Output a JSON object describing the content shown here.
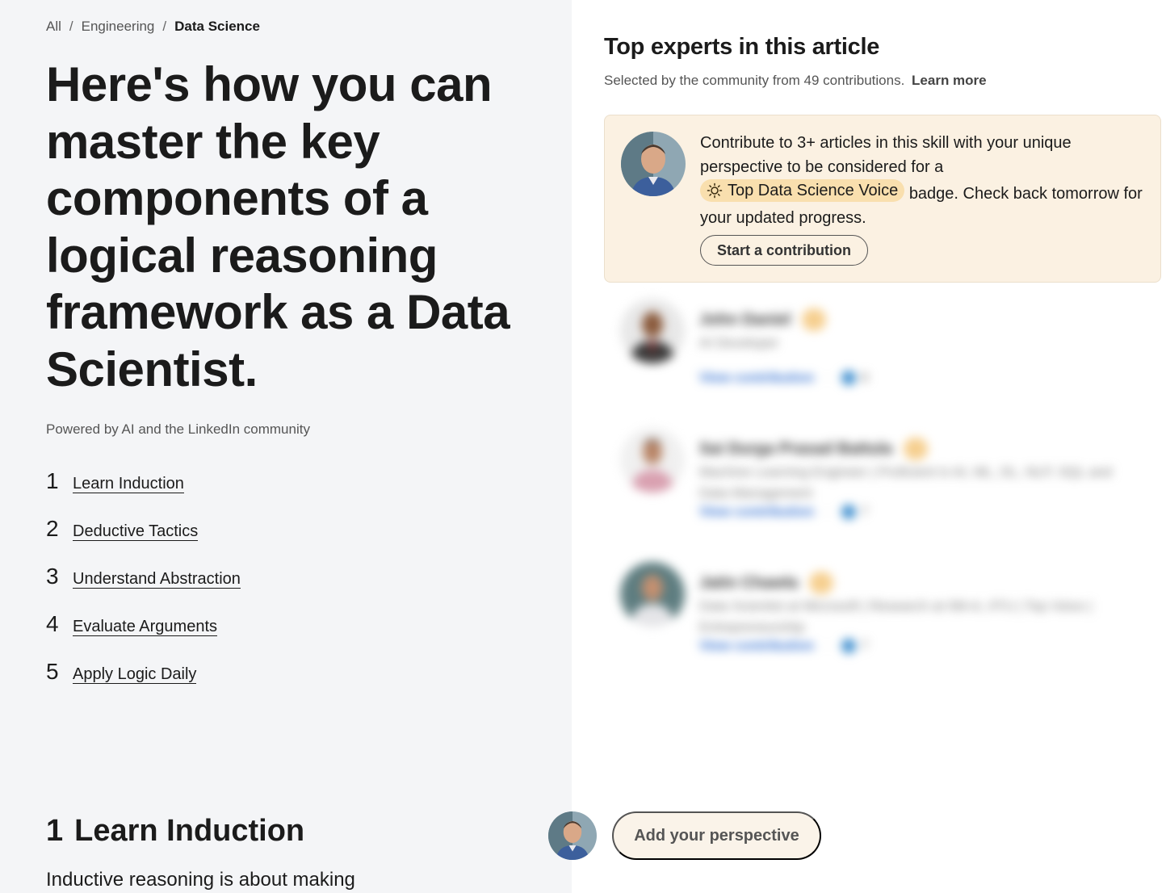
{
  "breadcrumb": {
    "items": [
      "All",
      "Engineering",
      "Data Science"
    ],
    "separator": "/"
  },
  "article": {
    "title": "Here's how you can master the key components of a logical reasoning framework as a Data Scientist.",
    "powered_by": "Powered by AI and the LinkedIn community"
  },
  "toc": [
    {
      "num": "1",
      "label": "Learn Induction"
    },
    {
      "num": "2",
      "label": "Deductive Tactics"
    },
    {
      "num": "3",
      "label": "Understand Abstraction"
    },
    {
      "num": "4",
      "label": "Evaluate Arguments"
    },
    {
      "num": "5",
      "label": "Apply Logic Daily"
    }
  ],
  "section": {
    "num": "1",
    "title": "Learn Induction",
    "text": "Inductive reasoning is about making"
  },
  "experts": {
    "title": "Top experts in this article",
    "subtitle": "Selected by the community from 49 contributions.",
    "learn_more": "Learn more",
    "contribute_card": {
      "text_before": "Contribute to 3+ articles in this skill with your unique perspective to be considered for a",
      "badge": "Top Data Science Voice",
      "text_after": "badge. Check back tomorrow for your updated progress.",
      "button": "Start a contribution"
    },
    "list": [
      {
        "name": "John Daniel",
        "role": "AI Developer",
        "view": "View contribution",
        "reactions": "8"
      },
      {
        "name": "Sai Durga Prasad Battula",
        "role": "Machine Learning Engineer | Proficient in AI, ML, DL, NLP, SQL and Data Management",
        "view": "View contribution",
        "reactions": "7"
      },
      {
        "name": "Jatin Chawla",
        "role": "Data Scientist at Microsoft | Research at IIM-A, IITU | Top Voice | Entrepreneurship",
        "view": "View contribution",
        "reactions": "7"
      }
    ]
  },
  "add_perspective": "Add your perspective",
  "colors": {
    "left_bg": "#f4f5f7",
    "card_bg": "#fbf1e2",
    "badge_bg": "#f9dfae",
    "link_blue": "#2a6bd0"
  }
}
